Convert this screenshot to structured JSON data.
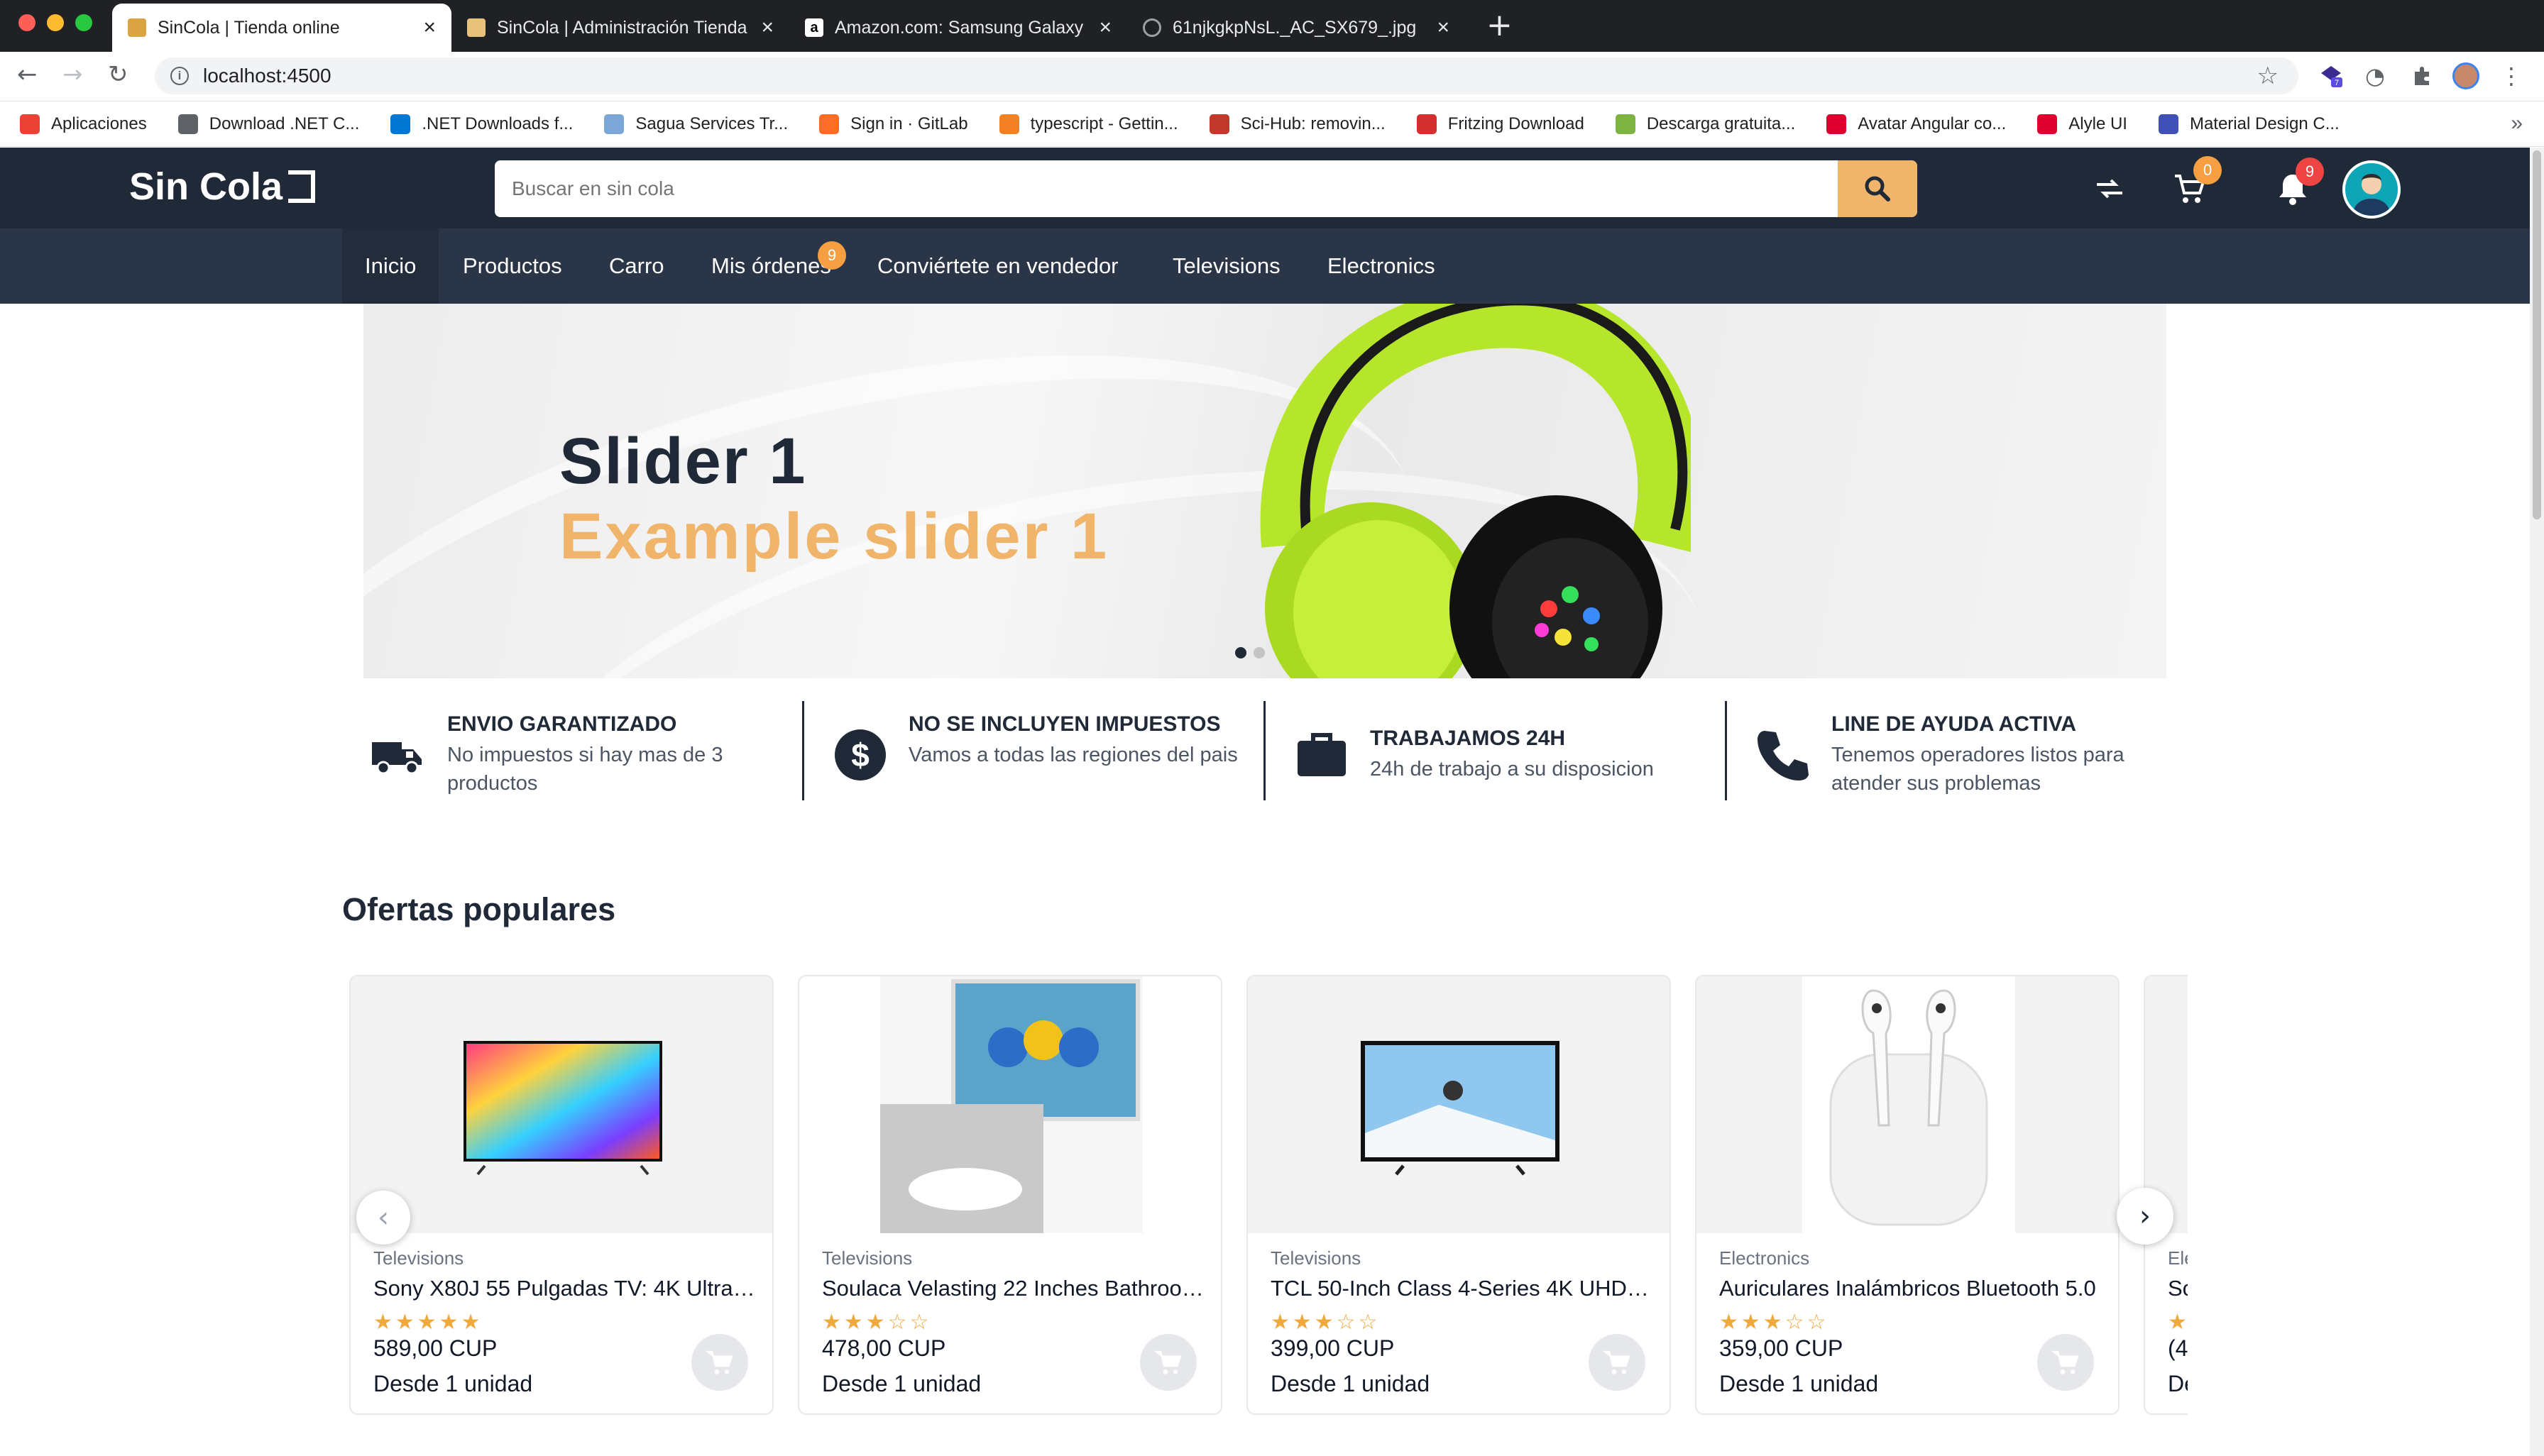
{
  "browser": {
    "tabs": [
      {
        "title": "SinCola | Tienda online",
        "active": true
      },
      {
        "title": "SinCola | Administración Tienda",
        "active": false
      },
      {
        "title": "Amazon.com: Samsung Galaxy",
        "active": false
      },
      {
        "title": "61njkgkpNsL._AC_SX679_.jpg",
        "active": false
      }
    ],
    "url": "localhost:4500",
    "extension_badge": "7",
    "bookmarks": [
      {
        "label": "Aplicaciones",
        "icon": "apps-grid-icon",
        "color": "#ea4335"
      },
      {
        "label": "Download .NET C...",
        "icon": "globe-icon",
        "color": "#5f6368"
      },
      {
        "label": ".NET Downloads f...",
        "icon": "windows-icon",
        "color": "#0078d4"
      },
      {
        "label": "Sagua Services Tr...",
        "icon": "sagua-icon",
        "color": "#7aa7d6"
      },
      {
        "label": "Sign in · GitLab",
        "icon": "gitlab-icon",
        "color": "#fc6d26"
      },
      {
        "label": "typescript - Gettin...",
        "icon": "stackoverflow-icon",
        "color": "#f48024"
      },
      {
        "label": "Sci-Hub: removin...",
        "icon": "scihub-icon",
        "color": "#c0392b"
      },
      {
        "label": "Fritzing Download",
        "icon": "fritzing-icon",
        "color": "#d32f2f"
      },
      {
        "label": "Descarga gratuita...",
        "icon": "download-icon",
        "color": "#7cb342"
      },
      {
        "label": "Avatar Angular co...",
        "icon": "angular-icon",
        "color": "#dd0031"
      },
      {
        "label": "Alyle UI",
        "icon": "angular-icon",
        "color": "#dd0031"
      },
      {
        "label": "Material Design C...",
        "icon": "material-icon",
        "color": "#3f51b5"
      }
    ],
    "bookmarks_more": "»"
  },
  "site": {
    "logo": "Sin Cola",
    "search_placeholder": "Buscar en sin cola",
    "cart_count": "0",
    "notifications_count": "9",
    "nav": [
      {
        "label": "Inicio",
        "active": true
      },
      {
        "label": "Productos"
      },
      {
        "label": "Carro"
      },
      {
        "label": "Mis órdenes",
        "badge": "9"
      },
      {
        "label": "Conviértete en vendedor"
      },
      {
        "label": "Televisions"
      },
      {
        "label": "Electronics"
      }
    ],
    "accent_color": "#f0b56b",
    "header_color": "#1f2937"
  },
  "hero": {
    "title": "Slider 1",
    "subtitle": "Example slider 1",
    "slides": 2,
    "active_slide": 1
  },
  "features": [
    {
      "title": "ENVIO GARANTIZADO",
      "desc": "No impuestos si hay mas de 3 productos",
      "icon": "truck-icon"
    },
    {
      "title": "NO SE INCLUYEN IMPUESTOS",
      "desc": "Vamos a todas las regiones del pais",
      "icon": "dollar-icon"
    },
    {
      "title": "TRABAJAMOS 24H",
      "desc": "24h de trabajo a su disposicion",
      "icon": "briefcase-icon"
    },
    {
      "title": "LINE DE AYUDA ACTIVA",
      "desc": "Tenemos operadores listos para atender sus problemas",
      "icon": "phone-icon"
    }
  ],
  "popular": {
    "title": "Ofertas populares",
    "products": [
      {
        "category": "Televisions",
        "name": "Sony X80J 55 Pulgadas TV: 4K Ultra HD",
        "rating": 5,
        "price": "589,00 CUP",
        "unit": "Desde 1 unidad",
        "image": "tv-colorful"
      },
      {
        "category": "Televisions",
        "name": "Soulaca Velasting 22 Inches Bathroom TV",
        "rating": 3,
        "price": "478,00 CUP",
        "unit": "Desde 1 unidad",
        "image": "tv-bathroom"
      },
      {
        "category": "Televisions",
        "name": "TCL 50-Inch Class 4-Series 4K UHD Smart TV",
        "rating": 3,
        "price": "399,00 CUP",
        "unit": "Desde 1 unidad",
        "image": "tv-ski"
      },
      {
        "category": "Electronics",
        "name": "Auriculares Inalámbricos Bluetooth 5.0",
        "rating": 3,
        "price": "359,00 CUP",
        "unit": "Desde 1 unidad",
        "image": "earbuds"
      },
      {
        "category": "Ele",
        "name": "Sc",
        "rating": 1,
        "price": "(4",
        "unit": "De",
        "image": "partial"
      }
    ]
  }
}
